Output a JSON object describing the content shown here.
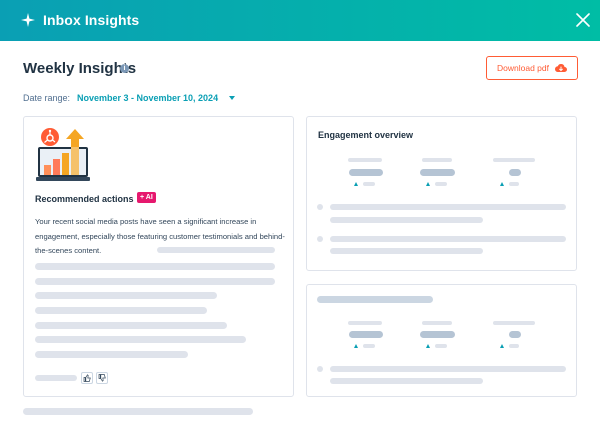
{
  "header": {
    "title": "Inbox Insights",
    "spark_icon": "sparkle-icon",
    "close_icon": "close-icon",
    "gradient_start": "#0a9fb4",
    "gradient_end": "#00bda5"
  },
  "page": {
    "title": "Weekly Insights",
    "info_icon": "info-icon"
  },
  "toolbar": {
    "download_label": "Download pdf",
    "download_icon": "cloud-download-icon",
    "accent": "#ff5c35"
  },
  "date_range": {
    "label": "Date range:",
    "value": "November 3 - November 10, 2024"
  },
  "recommended": {
    "title": "Recommended actions",
    "badge": "+ AI",
    "text": "Your recent social media posts have seen a significant increase in engagement, especially those featuring customer testimonials and behind-the-scenes content.",
    "feedback_icons": [
      "thumbs-up-icon",
      "thumbs-down-icon"
    ]
  },
  "engagement": {
    "title": "Engagement overview"
  }
}
